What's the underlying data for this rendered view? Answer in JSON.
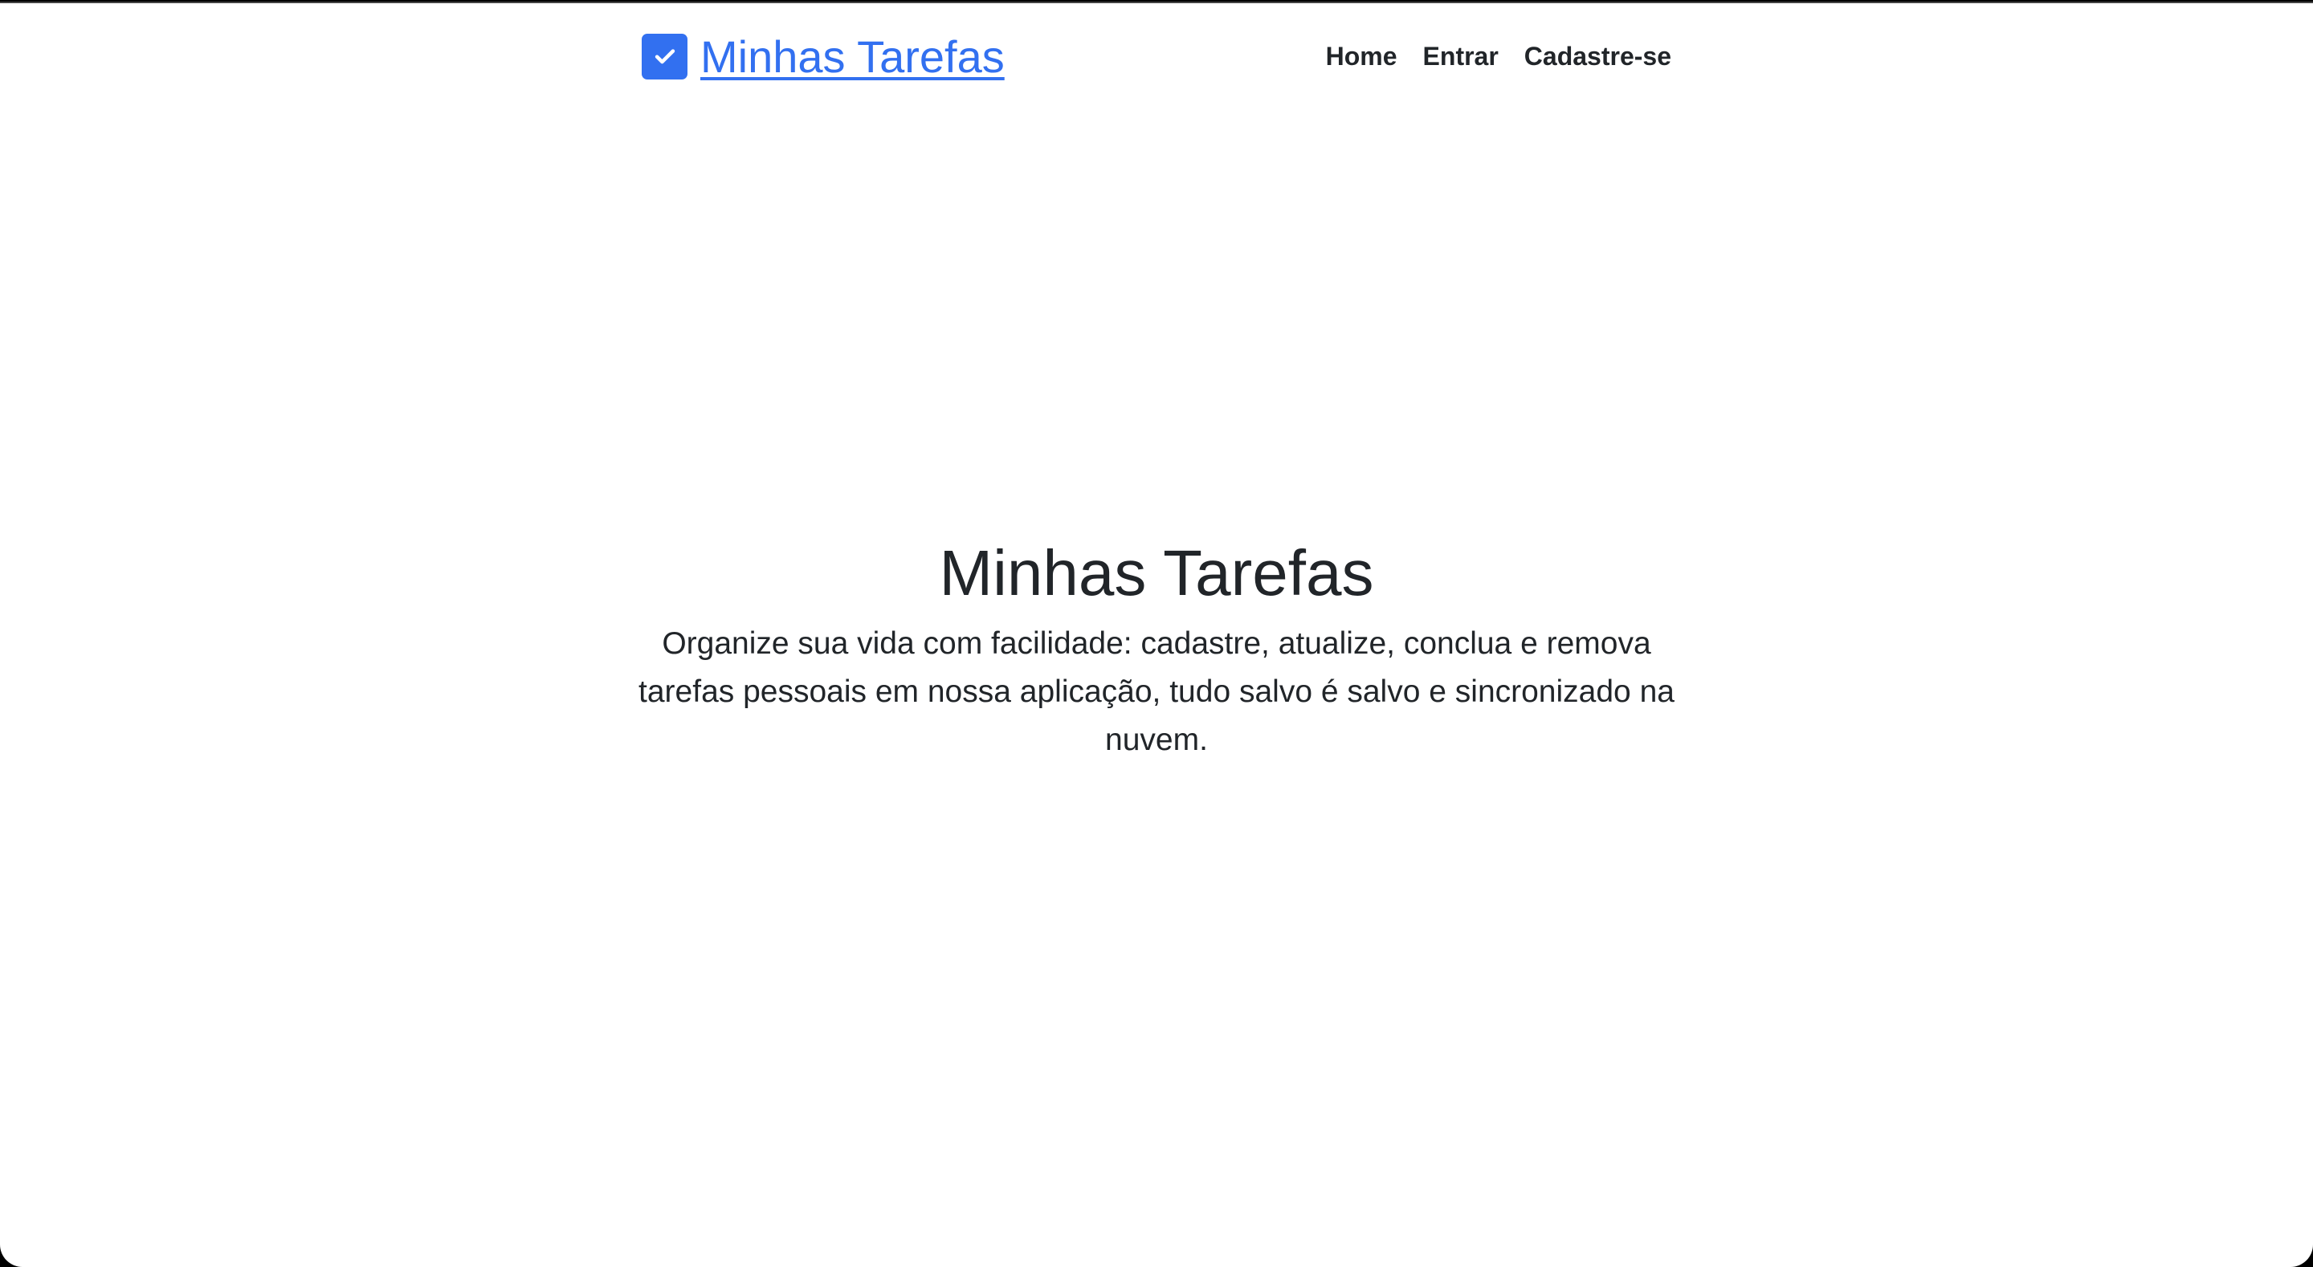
{
  "header": {
    "brand": "Minhas Tarefas",
    "brand_icon": "check-square-icon",
    "nav": [
      {
        "label": "Home"
      },
      {
        "label": "Entrar"
      },
      {
        "label": "Cadastre-se"
      }
    ]
  },
  "hero": {
    "title": "Minhas Tarefas",
    "description": "Organize sua vida com facilidade: cadastre, atualize, conclua e remova tarefas pessoais em nossa aplicação, tudo salvo é salvo e sincronizado na nuvem."
  },
  "colors": {
    "accent": "#3270f0",
    "text": "#212529"
  }
}
